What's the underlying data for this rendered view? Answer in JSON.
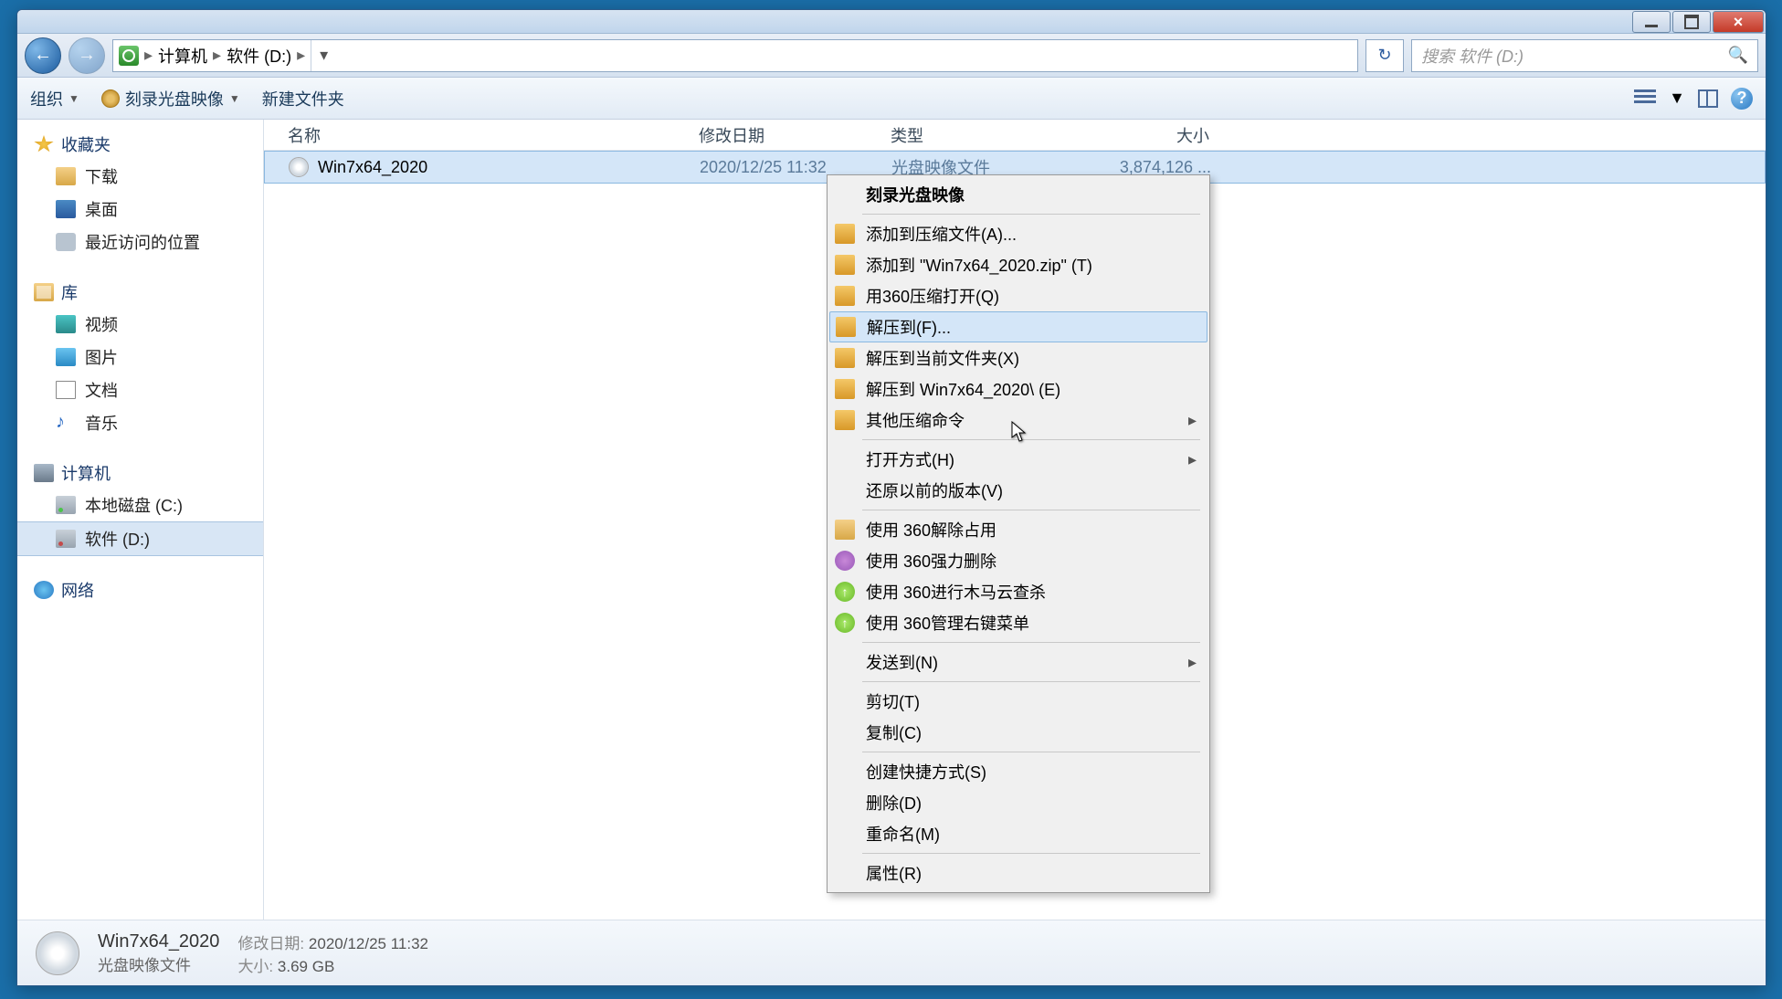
{
  "title_buttons": {
    "min": "min",
    "max": "max",
    "close": "×"
  },
  "nav": {
    "back": "←",
    "forward": "→",
    "breadcrumb": [
      "计算机",
      "软件 (D:)"
    ],
    "refresh": "↻",
    "search_placeholder": "搜索 软件 (D:)"
  },
  "toolbar": {
    "organize": "组织",
    "burn": "刻录光盘映像",
    "newfolder": "新建文件夹",
    "help": "?"
  },
  "sidebar": {
    "favorites": {
      "label": "收藏夹",
      "items": [
        "下载",
        "桌面",
        "最近访问的位置"
      ]
    },
    "libraries": {
      "label": "库",
      "items": [
        "视频",
        "图片",
        "文档",
        "音乐"
      ]
    },
    "computer": {
      "label": "计算机",
      "items": [
        "本地磁盘 (C:)",
        "软件 (D:)"
      ]
    },
    "network": {
      "label": "网络"
    }
  },
  "columns": {
    "name": "名称",
    "date": "修改日期",
    "type": "类型",
    "size": "大小"
  },
  "files": [
    {
      "name": "Win7x64_2020",
      "date": "2020/12/25 11:32",
      "type": "光盘映像文件",
      "size": "3,874,126 ..."
    }
  ],
  "context_menu": {
    "burn": "刻录光盘映像",
    "add_archive": "添加到压缩文件(A)...",
    "add_zip": "添加到 \"Win7x64_2020.zip\" (T)",
    "open_360zip": "用360压缩打开(Q)",
    "extract_to": "解压到(F)...",
    "extract_here": "解压到当前文件夹(X)",
    "extract_named": "解压到 Win7x64_2020\\ (E)",
    "other_zip": "其他压缩命令",
    "open_with": "打开方式(H)",
    "restore_prev": "还原以前的版本(V)",
    "unlock_360": "使用 360解除占用",
    "force_del_360": "使用 360强力删除",
    "scan_360": "使用 360进行木马云查杀",
    "manage_360": "使用 360管理右键菜单",
    "send_to": "发送到(N)",
    "cut": "剪切(T)",
    "copy": "复制(C)",
    "shortcut": "创建快捷方式(S)",
    "delete": "删除(D)",
    "rename": "重命名(M)",
    "properties": "属性(R)"
  },
  "details": {
    "name": "Win7x64_2020",
    "type": "光盘映像文件",
    "date_label": "修改日期:",
    "date": "2020/12/25 11:32",
    "size_label": "大小:",
    "size": "3.69 GB"
  }
}
